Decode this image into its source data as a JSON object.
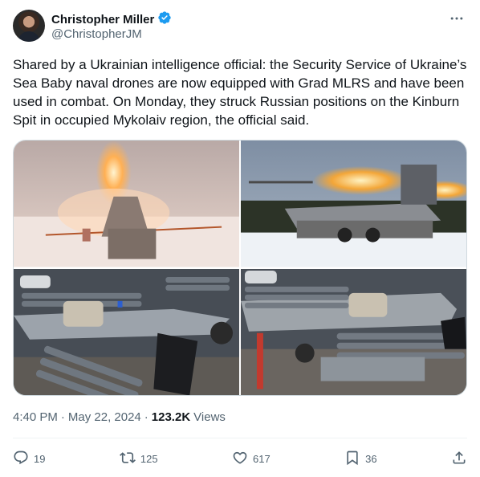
{
  "author": {
    "name": "Christopher Miller",
    "handle": "@ChristopherJM",
    "verified_badge": "verified-badge-icon",
    "badge_color": "#1d9bf0"
  },
  "tweet": {
    "text": "Shared by a Ukrainian intelligence official: the Security Service of Ukraine’s Sea Baby naval drones are now equipped with Grad MLRS and have been used in combat. On Monday, they struck Russian positions on the Kinburn Spit in occupied Mykolaiv region, the official said."
  },
  "meta": {
    "time": "4:40 PM",
    "separator": "·",
    "date": "May 22, 2024",
    "views_count": "123.2K",
    "views_label": "Views"
  },
  "actions": {
    "replies": "19",
    "reposts": "125",
    "likes": "617",
    "bookmarks": "36"
  },
  "colors": {
    "text_primary": "#0f1419",
    "text_secondary": "#536471",
    "border": "#cfd9de"
  }
}
